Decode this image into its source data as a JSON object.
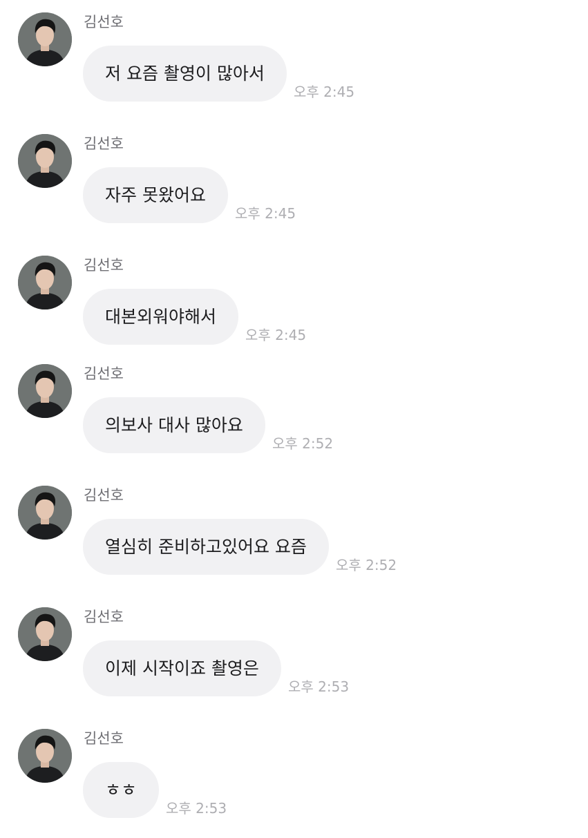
{
  "chat": {
    "messages": [
      {
        "sender": "김선호",
        "text": "저 요즘 촬영이 많아서",
        "time": "오후 2:45"
      },
      {
        "sender": "김선호",
        "text": "자주 못왔어요",
        "time": "오후 2:45"
      },
      {
        "sender": "김선호",
        "text": "대본외워야해서",
        "time": "오후 2:45"
      },
      {
        "sender": "김선호",
        "text": "의보사 대사 많아요",
        "time": "오후 2:52"
      },
      {
        "sender": "김선호",
        "text": "열심히 준비하고있어요 요즘",
        "time": "오후 2:52"
      },
      {
        "sender": "김선호",
        "text": "이제 시작이죠 촬영은",
        "time": "오후 2:53"
      },
      {
        "sender": "김선호",
        "text": "ㅎㅎ",
        "time": "오후 2:53"
      }
    ]
  }
}
